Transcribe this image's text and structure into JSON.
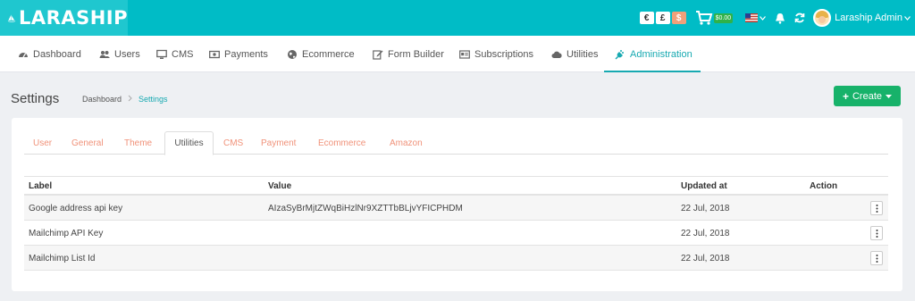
{
  "app": {
    "brand": "LARASHIP"
  },
  "topbar": {
    "currencies": [
      "€",
      "£",
      "$"
    ],
    "cart_total": "$0.00",
    "user_name": "Laraship Admin"
  },
  "nav": {
    "items": [
      {
        "label": "Dashboard",
        "icon": "dashboard-icon"
      },
      {
        "label": "Users",
        "icon": "users-icon"
      },
      {
        "label": "CMS",
        "icon": "monitor-icon"
      },
      {
        "label": "Payments",
        "icon": "money-icon"
      },
      {
        "label": "Ecommerce",
        "icon": "globe-icon"
      },
      {
        "label": "Form Builder",
        "icon": "edit-icon"
      },
      {
        "label": "Subscriptions",
        "icon": "id-card-icon"
      },
      {
        "label": "Utilities",
        "icon": "cloud-icon"
      },
      {
        "label": "Administration",
        "icon": "plug-icon"
      }
    ],
    "active": "Administration"
  },
  "page": {
    "title": "Settings",
    "breadcrumb": [
      "Dashboard",
      "Settings"
    ],
    "create_label": "Create"
  },
  "tabs": [
    "User",
    "General",
    "Theme",
    "Utilities",
    "CMS",
    "Payment",
    "Ecommerce",
    "Amazon"
  ],
  "active_tab": "Utilities",
  "table": {
    "headers": [
      "Label",
      "Value",
      "Updated at",
      "Action"
    ],
    "rows": [
      {
        "label": "Google address api key",
        "value": "AIzaSyBrMjtZWqBiHzlNr9XZTTbBLjvYFICPHDM",
        "updated": "22 Jul, 2018"
      },
      {
        "label": "Mailchimp API Key",
        "value": "",
        "updated": "22 Jul, 2018"
      },
      {
        "label": "Mailchimp List Id",
        "value": "",
        "updated": "22 Jul, 2018"
      }
    ]
  },
  "colors": {
    "topbar": "#00bcc6",
    "accent": "#17a9b1",
    "create_button": "#17b26a",
    "tab_inactive": "#f0927a"
  }
}
